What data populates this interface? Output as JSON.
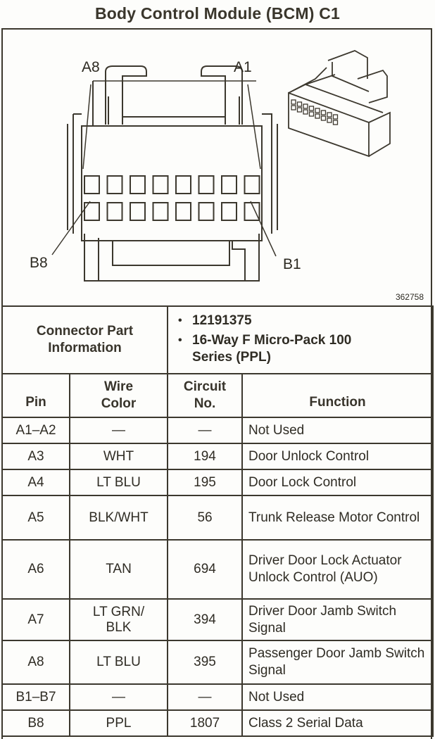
{
  "title": "Body Control Module (BCM) C1",
  "figure": {
    "labels": {
      "a8": "A8",
      "a1": "A1",
      "b8": "B8",
      "b1": "B1"
    },
    "figure_number": "362758",
    "cavity_rows": 2,
    "cavities_per_row": 8
  },
  "connector_info": {
    "label": "Connector Part Information",
    "items": [
      "12191375",
      "16-Way F Micro-Pack 100 Series (PPL)"
    ]
  },
  "table": {
    "headers": {
      "pin": "Pin",
      "wire_color": "Wire Color",
      "circuit_no": "Circuit No.",
      "function": "Function"
    },
    "rows": [
      {
        "pin": "A1–A2",
        "wire_color": "—",
        "circuit_no": "—",
        "function": "Not Used"
      },
      {
        "pin": "A3",
        "wire_color": "WHT",
        "circuit_no": "194",
        "function": "Door Unlock Control"
      },
      {
        "pin": "A4",
        "wire_color": "LT BLU",
        "circuit_no": "195",
        "function": "Door Lock Control"
      },
      {
        "pin": "A5",
        "wire_color": "BLK/WHT",
        "circuit_no": "56",
        "function": "Trunk Release Motor Control"
      },
      {
        "pin": "A6",
        "wire_color": "TAN",
        "circuit_no": "694",
        "function": "Driver Door Lock Actuator Unlock Control (AUO)"
      },
      {
        "pin": "A7",
        "wire_color": "LT GRN/ BLK",
        "circuit_no": "394",
        "function": "Driver Door Jamb Switch Signal"
      },
      {
        "pin": "A8",
        "wire_color": "LT BLU",
        "circuit_no": "395",
        "function": "Passenger Door Jamb Switch Signal"
      },
      {
        "pin": "B1–B7",
        "wire_color": "—",
        "circuit_no": "—",
        "function": "Not Used"
      },
      {
        "pin": "B8",
        "wire_color": "PPL",
        "circuit_no": "1807",
        "function": "Class 2 Serial Data"
      }
    ]
  }
}
